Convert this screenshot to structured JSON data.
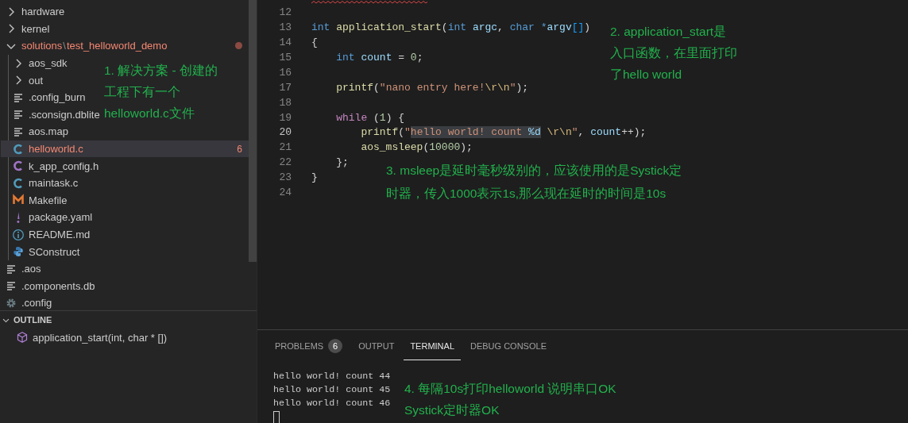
{
  "explorer": {
    "items": [
      {
        "name": "hardware",
        "kind": "folder",
        "expanded": false,
        "selected": false,
        "has_errors": false
      },
      {
        "name": "kernel",
        "kind": "folder",
        "expanded": false,
        "selected": false,
        "has_errors": false
      },
      {
        "name": "solutions",
        "separator": "\\",
        "subfolder": "test_helloworld_demo",
        "kind": "folder",
        "expanded": true,
        "selected": false,
        "has_errors": true,
        "modified_dot": true,
        "children": [
          {
            "name": "aos_sdk",
            "kind": "folder",
            "expanded": false,
            "selected": false,
            "has_errors": false
          },
          {
            "name": "out",
            "kind": "folder",
            "expanded": false,
            "selected": false,
            "has_errors": false
          },
          {
            "name": ".config_burn",
            "kind": "text",
            "selected": false,
            "has_errors": false
          },
          {
            "name": ".sconsign.dblite",
            "kind": "text",
            "selected": false,
            "has_errors": false
          },
          {
            "name": "aos.map",
            "kind": "text",
            "selected": false,
            "has_errors": false
          },
          {
            "name": "helloworld.c",
            "kind": "c",
            "selected": true,
            "has_errors": true,
            "badge": "6"
          },
          {
            "name": "k_app_config.h",
            "kind": "h",
            "selected": false,
            "has_errors": false
          },
          {
            "name": "maintask.c",
            "kind": "c",
            "selected": false,
            "has_errors": false
          },
          {
            "name": "Makefile",
            "kind": "make",
            "selected": false,
            "has_errors": false
          },
          {
            "name": "package.yaml",
            "kind": "yaml",
            "selected": false,
            "has_errors": false
          },
          {
            "name": "README.md",
            "kind": "info",
            "selected": false,
            "has_errors": false
          },
          {
            "name": "SConstruct",
            "kind": "python",
            "selected": false,
            "has_errors": false
          }
        ]
      },
      {
        "name": ".aos",
        "kind": "text",
        "selected": false,
        "has_errors": false
      },
      {
        "name": ".components.db",
        "kind": "text",
        "selected": false,
        "has_errors": false
      },
      {
        "name": ".config",
        "kind": "gear",
        "selected": false,
        "has_errors": false
      }
    ]
  },
  "outline": {
    "title": "OUTLINE",
    "expanded": true,
    "items": [
      {
        "label": "application_start(int, char * [])"
      }
    ]
  },
  "editor": {
    "lines": [
      {
        "number": "12",
        "current": false
      },
      {
        "number": "13",
        "current": false,
        "tokens": [
          {
            "t": "int ",
            "kind": "keyword"
          },
          {
            "t": "application_start",
            "kind": "function"
          },
          {
            "t": "(",
            "kind": "plain"
          },
          {
            "t": "int ",
            "kind": "keyword"
          },
          {
            "t": "argc",
            "kind": "variable"
          },
          {
            "t": ", ",
            "kind": "plain"
          },
          {
            "t": "char *",
            "kind": "keyword"
          },
          {
            "t": "argv",
            "kind": "variable"
          },
          {
            "t": "[]",
            "kind": "bracket"
          },
          {
            "t": ")",
            "kind": "plain"
          }
        ]
      },
      {
        "number": "14",
        "current": false,
        "tokens": [
          {
            "t": "{",
            "kind": "plain"
          }
        ]
      },
      {
        "number": "15",
        "current": false,
        "tokens": [
          {
            "t": "    int ",
            "kind": "keyword"
          },
          {
            "t": "count",
            "kind": "variable"
          },
          {
            "t": " = ",
            "kind": "plain"
          },
          {
            "t": "0",
            "kind": "number"
          },
          {
            "t": ";",
            "kind": "plain"
          }
        ]
      },
      {
        "number": "16",
        "current": false
      },
      {
        "number": "17",
        "current": false,
        "tokens": [
          {
            "t": "    printf",
            "kind": "function"
          },
          {
            "t": "(",
            "kind": "plain"
          },
          {
            "t": "\"nano entry here!",
            "kind": "string"
          },
          {
            "t": "\\r\\n",
            "kind": "escape"
          },
          {
            "t": "\"",
            "kind": "string"
          },
          {
            "t": ");",
            "kind": "plain"
          }
        ]
      },
      {
        "number": "18",
        "current": false
      },
      {
        "number": "19",
        "current": false,
        "tokens": [
          {
            "t": "    while",
            "kind": "control"
          },
          {
            "t": " (",
            "kind": "plain"
          },
          {
            "t": "1",
            "kind": "number"
          },
          {
            "t": ") {",
            "kind": "plain"
          }
        ]
      },
      {
        "number": "20",
        "current": true,
        "tokens": [
          {
            "t": "        printf",
            "kind": "function"
          },
          {
            "t": "(",
            "kind": "plain"
          },
          {
            "t": "\"",
            "kind": "string"
          },
          {
            "t": "hello world! count ",
            "kind": "string",
            "highlight": true
          },
          {
            "t": "%d",
            "kind": "variable",
            "highlight": true
          },
          {
            "t": " \\r\\n",
            "kind": "escape"
          },
          {
            "t": "\"",
            "kind": "string"
          },
          {
            "t": ", ",
            "kind": "plain"
          },
          {
            "t": "count",
            "kind": "variable"
          },
          {
            "t": "++);",
            "kind": "plain"
          }
        ]
      },
      {
        "number": "21",
        "current": false,
        "tokens": [
          {
            "t": "        aos_msleep",
            "kind": "function"
          },
          {
            "t": "(",
            "kind": "plain"
          },
          {
            "t": "10000",
            "kind": "number"
          },
          {
            "t": ");",
            "kind": "plain"
          }
        ]
      },
      {
        "number": "22",
        "current": false,
        "tokens": [
          {
            "t": "    };",
            "kind": "plain"
          }
        ]
      },
      {
        "number": "23",
        "current": false,
        "tokens": [
          {
            "t": "}",
            "kind": "plain"
          }
        ]
      },
      {
        "number": "24",
        "current": false
      }
    ]
  },
  "panel": {
    "tabs": [
      {
        "label": "PROBLEMS",
        "badge": "6",
        "selected": false
      },
      {
        "label": "OUTPUT",
        "selected": false
      },
      {
        "label": "TERMINAL",
        "selected": true
      },
      {
        "label": "DEBUG CONSOLE",
        "selected": false
      }
    ],
    "terminal_lines": [
      "hello world! count 44",
      "hello world! count 45",
      "hello world! count 46"
    ]
  },
  "annotations": [
    {
      "lines": [
        "1. 解决方案 - 创建的",
        "工程下有一个",
        "helloworld.c文件"
      ]
    },
    {
      "lines": [
        "2. application_start是",
        "入口函数，在里面打印",
        "了hello world"
      ]
    },
    {
      "lines": [
        "3. msleep是延时毫秒级别的，应该使用的是Systick定",
        "时器，传入1000表示1s,那么现在延时的时间是10s"
      ]
    },
    {
      "lines": [
        "4. 每隔10s打印helloworld 说明串口OK",
        "Systick定时器OK"
      ]
    }
  ]
}
